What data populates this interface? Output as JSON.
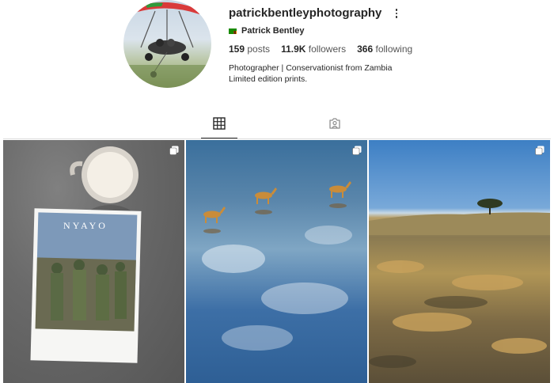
{
  "profile": {
    "username": "patrickbentleyphotography",
    "full_name": "Patrick Bentley",
    "flag_icon": "zambia-flag-icon",
    "posts_count": "159",
    "posts_label": "posts",
    "followers_count": "11.9K",
    "followers_label": "followers",
    "following_count": "366",
    "following_label": "following",
    "bio_line1": "Photographer | Conservationist from Zambia",
    "bio_line2": "Limited edition prints."
  },
  "tabs": [
    {
      "name": "posts",
      "icon": "grid-icon",
      "active": true
    },
    {
      "name": "tagged",
      "icon": "tagged-user-icon",
      "active": false
    }
  ],
  "posts": [
    {
      "description": "magazine-and-coffee",
      "magazine_title": "NYAYO",
      "multiple": true
    },
    {
      "description": "antelopes-in-water",
      "multiple": true
    },
    {
      "description": "savanna-landscape",
      "multiple": true
    }
  ],
  "colors": {
    "text": "#262626",
    "secondary": "#555555",
    "divider": "#dbdbdb",
    "flag_green": "#198a00"
  }
}
